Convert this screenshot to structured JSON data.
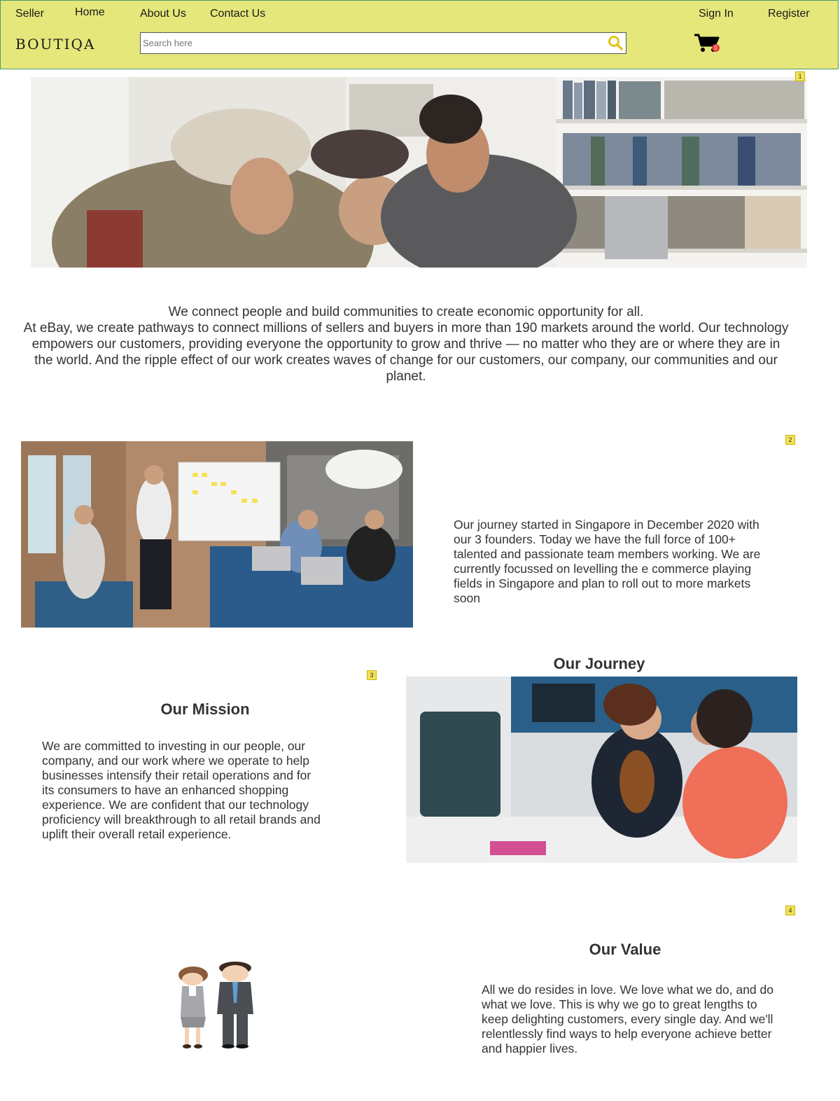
{
  "nav": {
    "seller": "Seller",
    "home": "Home",
    "about": "About Us",
    "contact": "Contact Us",
    "sign_in": "Sign In",
    "register": "Register",
    "logo": "BOUTIQA",
    "search_placeholder": "Search here",
    "cart_count": "0"
  },
  "markers": [
    "1",
    "2",
    "3",
    "4"
  ],
  "intro": {
    "line1": "We connect people and build communities to create economic opportunity for all.",
    "line2": "At eBay, we create pathways to connect millions of sellers and buyers in more than 190 markets around the world. Our technology empowers our customers, providing everyone the opportunity to grow and thrive — no matter who they are or where they are in the world. And the ripple effect of our work creates waves of change for our customers, our company, our communities and our planet."
  },
  "journey": {
    "text": "Our journey started in Singapore in December 2020 with our 3 founders. Today we have the full force of 100+ talented and passionate team members working. We are currently focussed on levelling the e commerce playing fields in Singapore and plan to roll out to more markets soon",
    "heading": "Our Journey"
  },
  "mission": {
    "heading": "Our Mission",
    "text": "We are committed to investing in our people, our company, and our work where we operate to help businesses intensify their retail operations and for its consumers to have an enhanced shopping experience. We are confident that our technology proficiency will breakthrough to all retail brands and uplift their overall retail experience."
  },
  "value": {
    "heading": "Our Value",
    "text": "All we do resides in love. We love what we do, and do what we love. This is why we go to great lengths to keep delighting customers, every single day. And we'll relentlessly find ways to help everyone achieve better and happier lives."
  },
  "colors": {
    "navbar_bg": "#e5e77a",
    "navbar_border": "#4a9a6a",
    "search_icon": "#e0c51c",
    "cart_badge": "#e53935"
  }
}
